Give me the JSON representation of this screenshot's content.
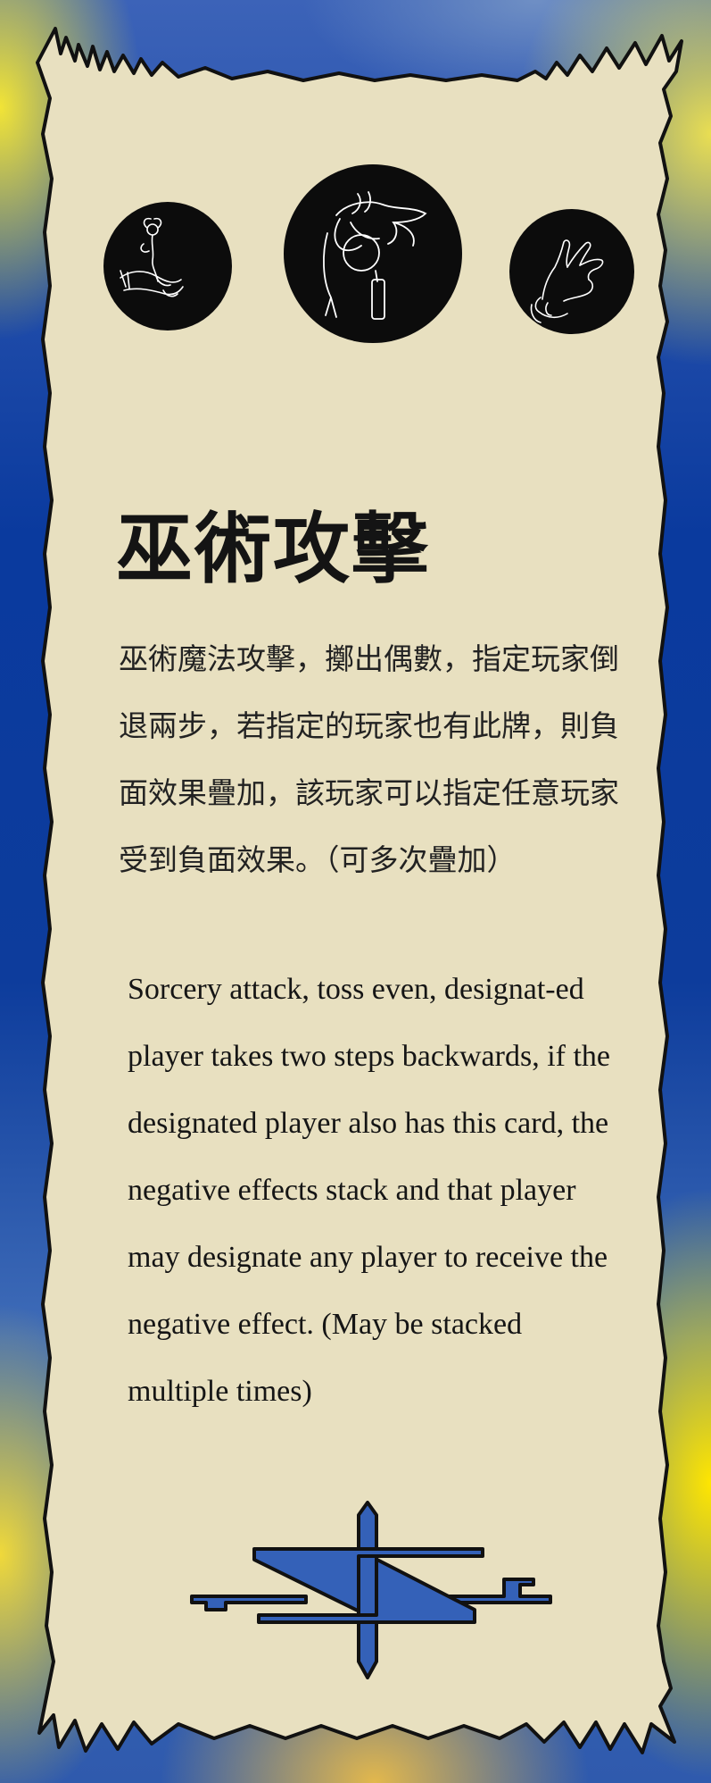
{
  "card": {
    "title": "巫術攻擊",
    "description_zh": "巫術魔法攻擊，擲出偶數，指定玩家倒退兩步，若指定的玩家也有此牌，則負面效果疊加，該玩家可以指定任意玩家受到負面效果。（可多次疊加）",
    "description_en": "Sorcery attack, toss even, designat-ed player takes two steps backwards, if the designated player also has this card, the negative effects stack and that player may designate any player to receive the negative effect. (May be stacked multiple times)"
  },
  "icons": {
    "medallion_left": "hand-holding-flower-icon",
    "medallion_center": "hand-holding-prayer-beads-icon",
    "medallion_right": "mudra-hand-icon",
    "emblem": "sorcery-glyph-icon"
  },
  "colors": {
    "parchment": "#e8e0c0",
    "ink": "#111111",
    "glyph_blue": "#3461b8",
    "border_blue": "#0a3a9e",
    "border_yellow": "#ffe600"
  }
}
